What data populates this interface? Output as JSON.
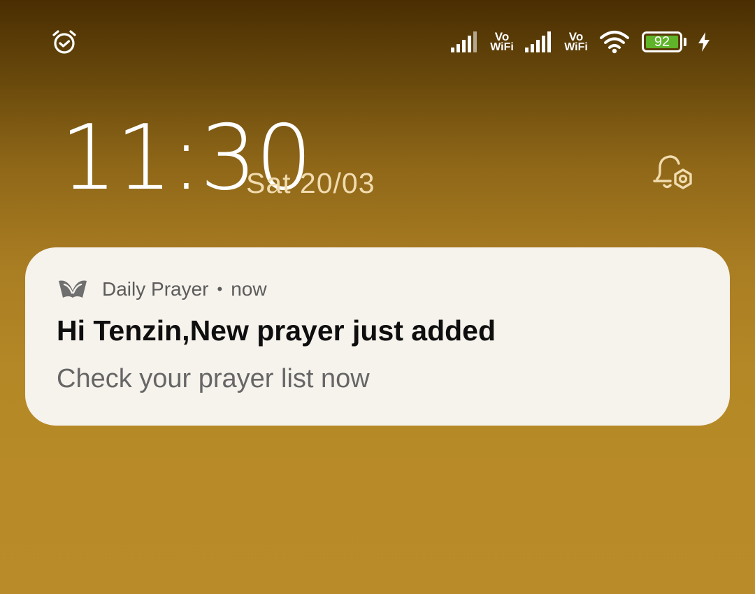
{
  "status_bar": {
    "alarm_icon": "alarm-clock-icon",
    "signal_icon": "cell-signal-icon",
    "vowifi_1": {
      "vo": "Vo",
      "wifi": "WiFi"
    },
    "vowifi_2": {
      "vo": "Vo",
      "wifi": "WiFi"
    },
    "wifi_icon": "wifi-icon",
    "battery_percent": "92",
    "battery_color": "#5fb42a",
    "charging_icon": "lightning-bolt-icon"
  },
  "lockscreen": {
    "time": "11:30",
    "date": "Sat 20/03",
    "notification_settings_icon": "bell-settings-icon"
  },
  "notification": {
    "app_icon": "praying-hands-icon",
    "app_name": "Daily Prayer",
    "separator": "•",
    "time": "now",
    "title": "Hi Tenzin,New prayer just added",
    "body": "Check your prayer list now"
  }
}
